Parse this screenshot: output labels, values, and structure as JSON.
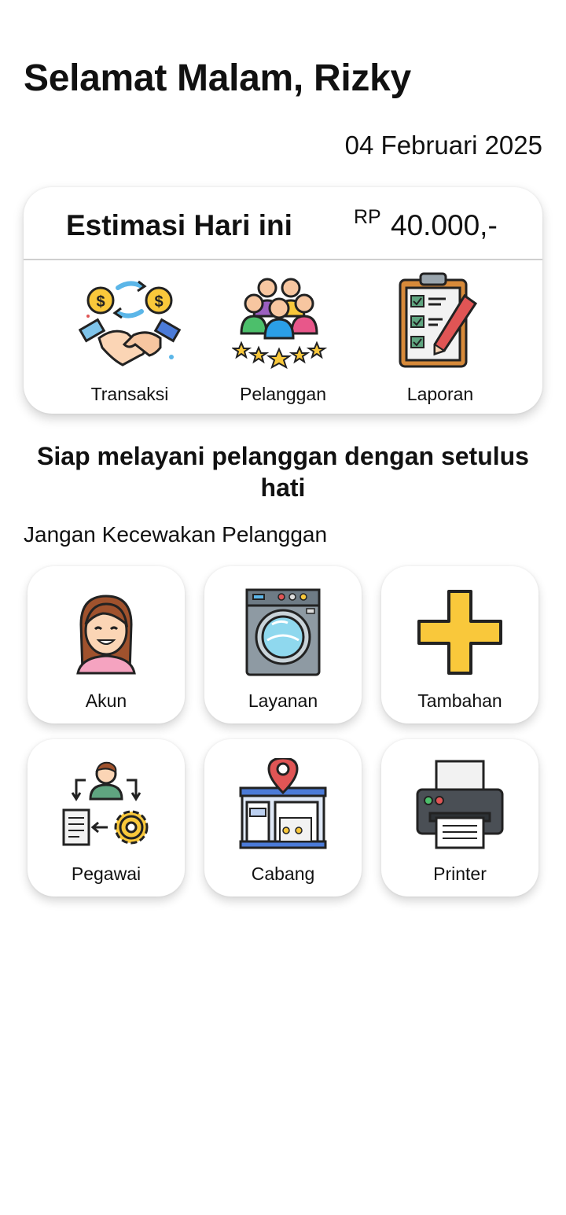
{
  "header": {
    "greeting": "Selamat Malam, Rizky",
    "date": "04 Februari 2025"
  },
  "summary": {
    "title": "Estimasi Hari ini",
    "currency": "RP",
    "amount": "40.000,-",
    "actions": [
      {
        "label": "Transaksi",
        "icon": "handshake-money-icon"
      },
      {
        "label": "Pelanggan",
        "icon": "customers-stars-icon"
      },
      {
        "label": "Laporan",
        "icon": "clipboard-checklist-icon"
      }
    ]
  },
  "tagline": "Siap melayani pelanggan dengan setulus hati",
  "section_label": "Jangan Kecewakan Pelanggan",
  "menu": [
    {
      "label": "Akun",
      "icon": "user-avatar-icon"
    },
    {
      "label": "Layanan",
      "icon": "washing-machine-icon"
    },
    {
      "label": "Tambahan",
      "icon": "plus-icon"
    },
    {
      "label": "Pegawai",
      "icon": "employee-workflow-icon"
    },
    {
      "label": "Cabang",
      "icon": "branch-store-icon"
    },
    {
      "label": "Printer",
      "icon": "printer-icon"
    }
  ],
  "colors": {
    "text": "#111111",
    "card_bg": "#ffffff",
    "divider": "#cfcfcf",
    "accent_yellow": "#f9c83b"
  }
}
